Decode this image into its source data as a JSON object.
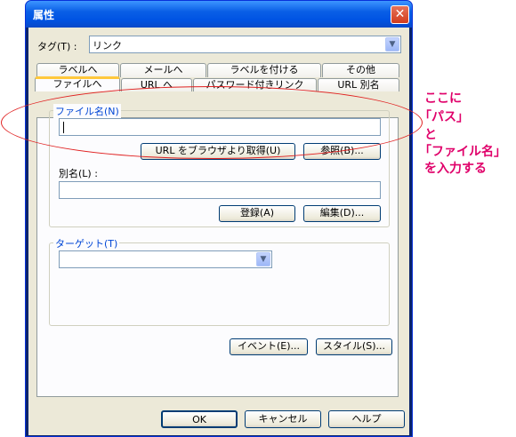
{
  "window": {
    "title": "属性",
    "close_symbol": "✕"
  },
  "tag": {
    "label": "タグ(T) :",
    "value": "リンク",
    "arrow": "▼"
  },
  "tabs_back": [
    "ラベルへ",
    "メールへ",
    "ラベルを付ける",
    "その他"
  ],
  "tabs_front": [
    "ファイルへ",
    "URL へ",
    "パスワード付きリンク",
    "URL 別名"
  ],
  "filename": {
    "group_label": "ファイル名(N)",
    "value": ""
  },
  "buttons": {
    "url_browser": "URL をブラウザより取得(U)",
    "browse": "参照(B)...",
    "register": "登録(A)",
    "edit": "編集(D)...",
    "event": "イベント(E)...",
    "style": "スタイル(S)...",
    "ok": "OK",
    "cancel": "キャンセル",
    "help": "ヘルプ"
  },
  "alias": {
    "label": "別名(L) :",
    "value": ""
  },
  "target": {
    "group_label": "ターゲット(T)",
    "value": "",
    "arrow": "▼"
  },
  "annotation": {
    "line1": "ここに",
    "line2": "「パス」",
    "line3": "と",
    "line4": "「ファイル名」",
    "line5": "を入力する"
  }
}
